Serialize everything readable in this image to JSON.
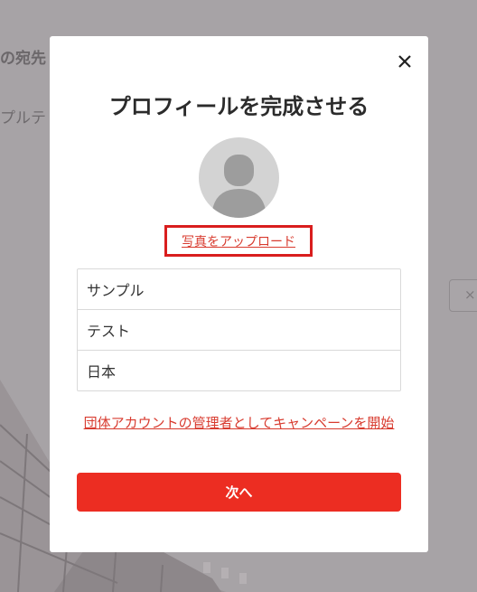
{
  "background": {
    "heading_fragment": "の宛先",
    "subtext_fragment": "プルテ",
    "close_glyph": "×"
  },
  "modal": {
    "title": "プロフィールを完成させる",
    "close_glyph": "×",
    "upload_photo_label": "写真をアップロード",
    "fields": [
      {
        "value": "サンプル"
      },
      {
        "value": "テスト"
      },
      {
        "value": "日本"
      }
    ],
    "org_campaign_link": "団体アカウントの管理者としてキャンペーンを開始",
    "next_button_label": "次へ"
  },
  "colors": {
    "accent_red": "#ec2d22",
    "link_red": "#d83b2f",
    "highlight_border": "#d91e1e",
    "overlay": "#a7a3a6"
  }
}
